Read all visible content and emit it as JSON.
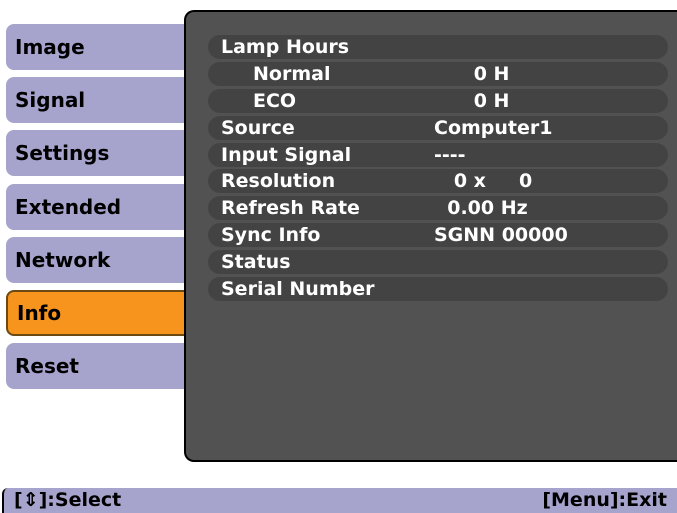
{
  "menu": {
    "items": [
      {
        "label": "Image"
      },
      {
        "label": "Signal"
      },
      {
        "label": "Settings"
      },
      {
        "label": "Extended"
      },
      {
        "label": "Network"
      },
      {
        "label": "Info"
      },
      {
        "label": "Reset"
      }
    ],
    "active": "Info"
  },
  "info": {
    "rows": [
      {
        "label": "Lamp Hours",
        "value": ""
      },
      {
        "label": "Normal",
        "value": "      0 H"
      },
      {
        "label": "ECO",
        "value": "      0 H"
      },
      {
        "label": "Source",
        "value": "Computer1"
      },
      {
        "label": "Input Signal",
        "value": "----"
      },
      {
        "label": "Resolution",
        "value": "   0 x     0"
      },
      {
        "label": "Refresh Rate",
        "value": "  0.00 Hz"
      },
      {
        "label": "Sync Info",
        "value": "SGNN 00000"
      },
      {
        "label": "Status",
        "value": ""
      },
      {
        "label": "Serial Number",
        "value": ""
      }
    ]
  },
  "help": {
    "select": "[⇕]:Select",
    "exit": "[Menu]:Exit"
  },
  "colors": {
    "tab": "#a6a4cc",
    "active_tab": "#f7941d",
    "panel": "#525252",
    "row": "#434343"
  }
}
